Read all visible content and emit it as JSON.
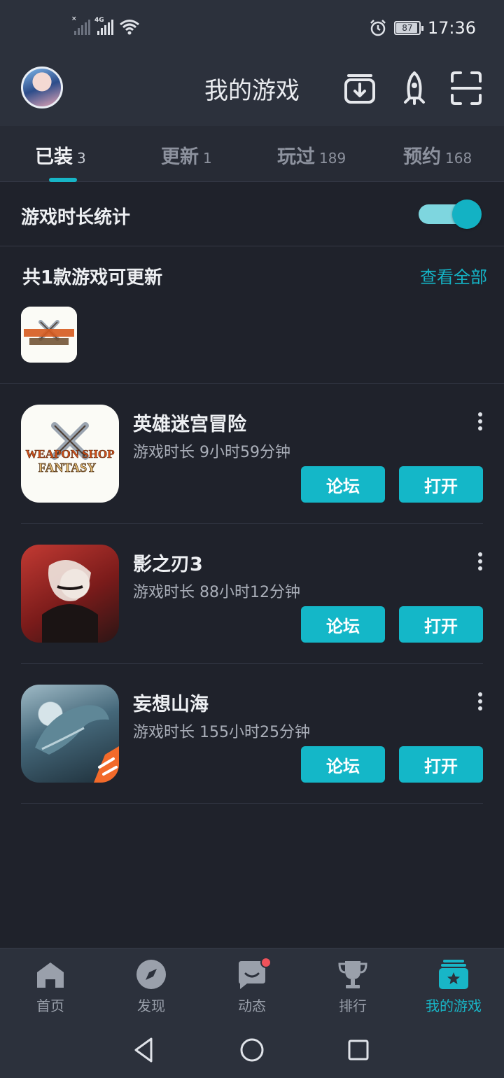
{
  "status": {
    "time": "17:36",
    "battery": "87",
    "network": "4G"
  },
  "header": {
    "title": "我的游戏"
  },
  "tabs": [
    {
      "label": "已装",
      "count": "3",
      "active": true
    },
    {
      "label": "更新",
      "count": "1",
      "active": false
    },
    {
      "label": "玩过",
      "count": "189",
      "active": false
    },
    {
      "label": "预约",
      "count": "168",
      "active": false
    }
  ],
  "stats": {
    "label": "游戏时长统计",
    "enabled": true
  },
  "updates": {
    "title": "共1款游戏可更新",
    "view_all": "查看全部"
  },
  "games": [
    {
      "name": "英雄迷宫冒险",
      "playtime": "游戏时长 9小时59分钟",
      "forum": "论坛",
      "open": "打开",
      "icon_text_1": "WEAPON SHOP",
      "icon_text_2": "FANTASY"
    },
    {
      "name": "影之刃3",
      "playtime": "游戏时长 88小时12分钟",
      "forum": "论坛",
      "open": "打开"
    },
    {
      "name": "妄想山海",
      "playtime": "游戏时长 155小时25分钟",
      "forum": "论坛",
      "open": "打开"
    }
  ],
  "bottom_nav": [
    {
      "label": "首页",
      "icon": "home-icon"
    },
    {
      "label": "发现",
      "icon": "compass-icon"
    },
    {
      "label": "动态",
      "icon": "chat-icon",
      "badge": true
    },
    {
      "label": "排行",
      "icon": "trophy-icon"
    },
    {
      "label": "我的游戏",
      "icon": "game-library-icon",
      "active": true
    }
  ],
  "colors": {
    "accent": "#14b7c8",
    "background": "#1f222b",
    "bar": "#2c313c",
    "badge": "#f0525a"
  }
}
